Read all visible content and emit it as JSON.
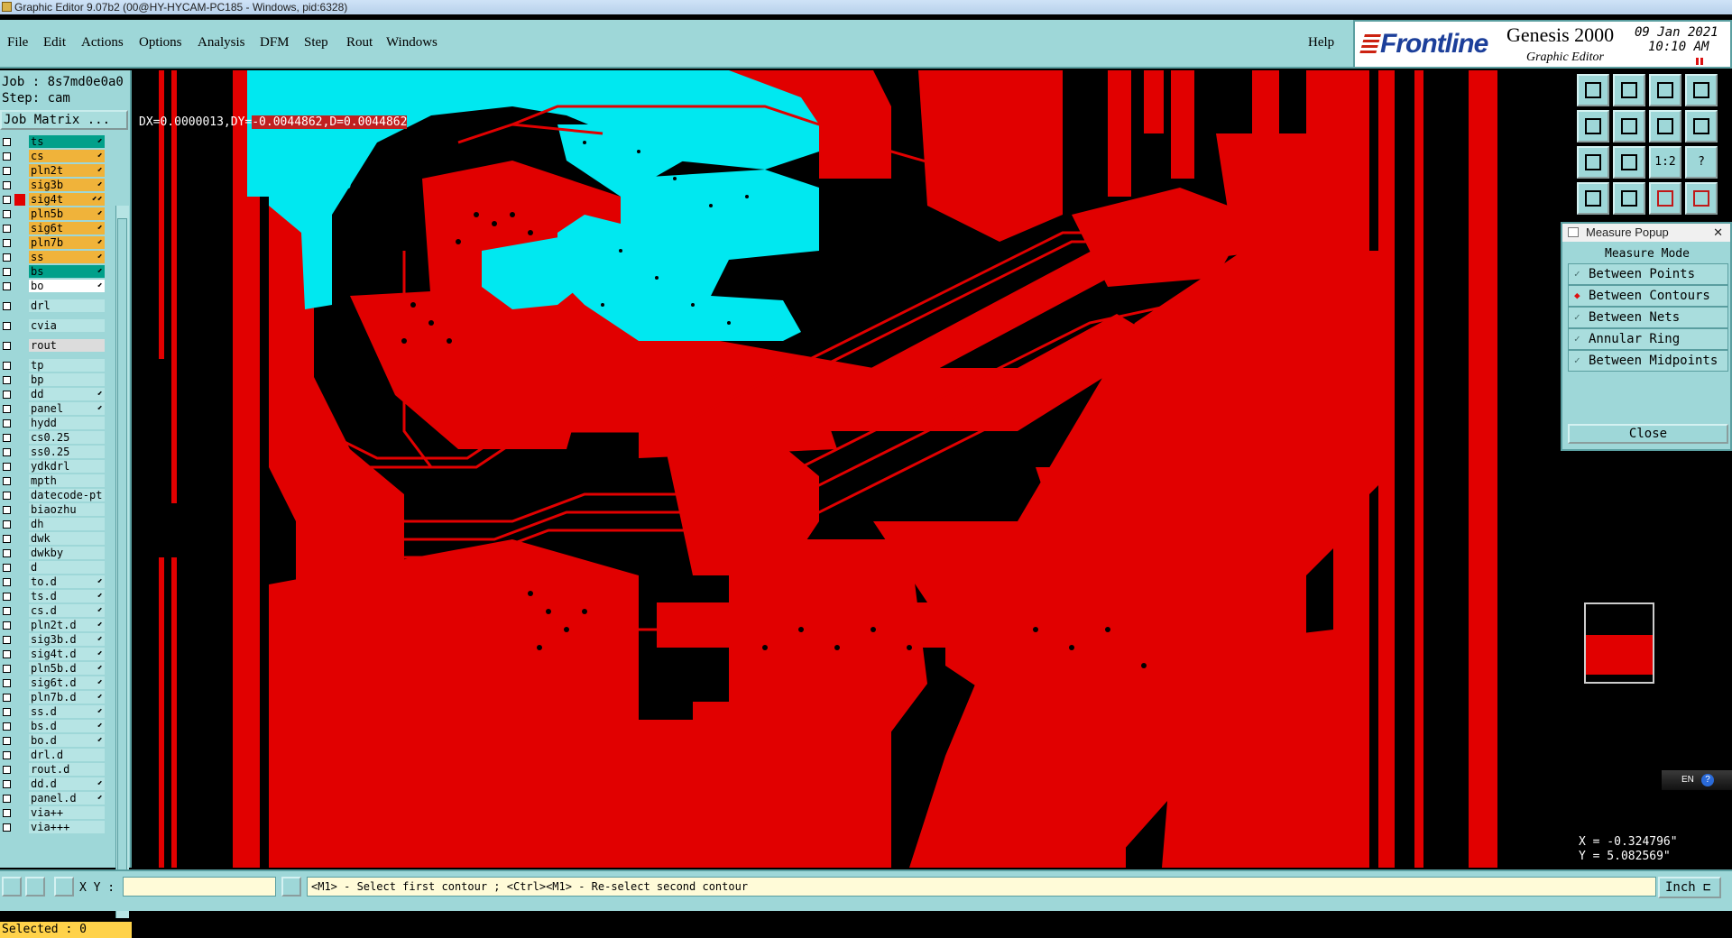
{
  "window": {
    "title": "Graphic Editor 9.07b2 (00@HY-HYCAM-PC185 - Windows, pid:6328)"
  },
  "menu": {
    "items": [
      "File",
      "Edit",
      "Actions",
      "Options",
      "Analysis",
      "DFM",
      "Step",
      "Rout",
      "Windows"
    ],
    "help": "Help"
  },
  "brand": {
    "logo": "Frontline",
    "product": "Genesis 2000",
    "subtitle": "Graphic Editor",
    "date": "09 Jan 2021",
    "time": "10:10 AM"
  },
  "job": {
    "job_line": "Job : 8s7md0e0a0",
    "step_line": "Step: cam",
    "matrix_button": "Job Matrix ...",
    "selected_line": "Selected : 0"
  },
  "layers": [
    {
      "name": "ts",
      "color": "#00a08a",
      "flag": "⬋"
    },
    {
      "name": "cs",
      "color": "#f0b33a",
      "flag": "⬋"
    },
    {
      "name": "pln2t",
      "color": "#f0b33a",
      "flag": "⬋"
    },
    {
      "name": "sig3b",
      "color": "#f0b33a",
      "flag": "⬋"
    },
    {
      "name": "sig4t",
      "color": "#f0b33a",
      "flag": "⬋⬋",
      "active": true
    },
    {
      "name": "pln5b",
      "color": "#f0b33a",
      "flag": "⬋"
    },
    {
      "name": "sig6t",
      "color": "#f0b33a",
      "flag": "⬋"
    },
    {
      "name": "pln7b",
      "color": "#f0b33a",
      "flag": "⬋"
    },
    {
      "name": "ss",
      "color": "#f0b33a",
      "flag": "⬋"
    },
    {
      "name": "bs",
      "color": "#00a08a",
      "flag": "⬋"
    },
    {
      "name": "bo",
      "color": "#ffffff",
      "flag": "⬋"
    },
    {
      "name": "drl",
      "color": "#b6e4e4",
      "flag": ""
    },
    {
      "name": "cvia",
      "color": "#b6e4e4",
      "flag": ""
    },
    {
      "name": "rout",
      "color": "#dcdcdc",
      "flag": ""
    },
    {
      "name": "tp",
      "color": "#b6e4e4",
      "flag": ""
    },
    {
      "name": "bp",
      "color": "#b6e4e4",
      "flag": ""
    },
    {
      "name": "dd",
      "color": "#b6e4e4",
      "flag": "⬋"
    },
    {
      "name": "panel",
      "color": "#b6e4e4",
      "flag": "⬋"
    },
    {
      "name": "hydd",
      "color": "#b6e4e4",
      "flag": ""
    },
    {
      "name": "cs0.25",
      "color": "#b6e4e4",
      "flag": ""
    },
    {
      "name": "ss0.25",
      "color": "#b6e4e4",
      "flag": ""
    },
    {
      "name": "ydkdrl",
      "color": "#b6e4e4",
      "flag": ""
    },
    {
      "name": "mpth",
      "color": "#b6e4e4",
      "flag": ""
    },
    {
      "name": "datecode-pt",
      "color": "#b6e4e4",
      "flag": ""
    },
    {
      "name": "biaozhu",
      "color": "#b6e4e4",
      "flag": ""
    },
    {
      "name": "dh",
      "color": "#b6e4e4",
      "flag": ""
    },
    {
      "name": "dwk",
      "color": "#b6e4e4",
      "flag": ""
    },
    {
      "name": "dwkby",
      "color": "#b6e4e4",
      "flag": ""
    },
    {
      "name": "d",
      "color": "#b6e4e4",
      "flag": ""
    },
    {
      "name": "to.d",
      "color": "#b6e4e4",
      "flag": "⬋"
    },
    {
      "name": "ts.d",
      "color": "#b6e4e4",
      "flag": "⬋"
    },
    {
      "name": "cs.d",
      "color": "#b6e4e4",
      "flag": "⬋"
    },
    {
      "name": "pln2t.d",
      "color": "#b6e4e4",
      "flag": "⬋"
    },
    {
      "name": "sig3b.d",
      "color": "#b6e4e4",
      "flag": "⬋"
    },
    {
      "name": "sig4t.d",
      "color": "#b6e4e4",
      "flag": "⬋"
    },
    {
      "name": "pln5b.d",
      "color": "#b6e4e4",
      "flag": "⬋"
    },
    {
      "name": "sig6t.d",
      "color": "#b6e4e4",
      "flag": "⬋"
    },
    {
      "name": "pln7b.d",
      "color": "#b6e4e4",
      "flag": "⬋"
    },
    {
      "name": "ss.d",
      "color": "#b6e4e4",
      "flag": "⬋"
    },
    {
      "name": "bs.d",
      "color": "#b6e4e4",
      "flag": "⬋"
    },
    {
      "name": "bo.d",
      "color": "#b6e4e4",
      "flag": "⬋"
    },
    {
      "name": "drl.d",
      "color": "#b6e4e4",
      "flag": ""
    },
    {
      "name": "rout.d",
      "color": "#b6e4e4",
      "flag": ""
    },
    {
      "name": "dd.d",
      "color": "#b6e4e4",
      "flag": "⬋"
    },
    {
      "name": "panel.d",
      "color": "#b6e4e4",
      "flag": "⬋"
    },
    {
      "name": "via++",
      "color": "#b6e4e4",
      "flag": ""
    },
    {
      "name": "via+++",
      "color": "#b6e4e4",
      "flag": ""
    }
  ],
  "readout": {
    "prefix": "DX=0.0000013,DY=",
    "highlight": "-0.0044862,D=0.0044862"
  },
  "measure": {
    "title": "Measure Popup",
    "mode_label": "Measure Mode",
    "options": [
      "Between Points",
      "Between Contours",
      "Between Nets",
      "Annular Ring",
      "Between Midpoints"
    ],
    "selected": "Between Contours",
    "close": "Close"
  },
  "toolbar_icons": [
    "zoom-home-icon",
    "zoom-in-icon",
    "zoom-out-icon",
    "zoom-fit-icon",
    "pan-left-icon",
    "pan-right-icon",
    "redraw-icon",
    "snap-icon",
    "fit-profile-icon",
    "pan-center-icon",
    "ratio-icon",
    "help-icon",
    "measure-icon",
    "pin-icon",
    "net-highlight-icon",
    "net-compare-icon"
  ],
  "toolbar_text": {
    "ratio": "1:2",
    "help": "?"
  },
  "ime": {
    "label": "EN",
    "help": "?"
  },
  "cursor": {
    "x": "X = -0.324796\"",
    "y": "Y = 5.082569\""
  },
  "bottom": {
    "xy_label": "X Y :",
    "xy_value": "",
    "prompt": "<M1> - Select first contour ; <Ctrl><M1> - Re-select second contour",
    "units": "Inch ⊏"
  },
  "colors": {
    "panel": "#9ed7d8",
    "copper": "#e10000",
    "highlight": "#00e8f0"
  }
}
